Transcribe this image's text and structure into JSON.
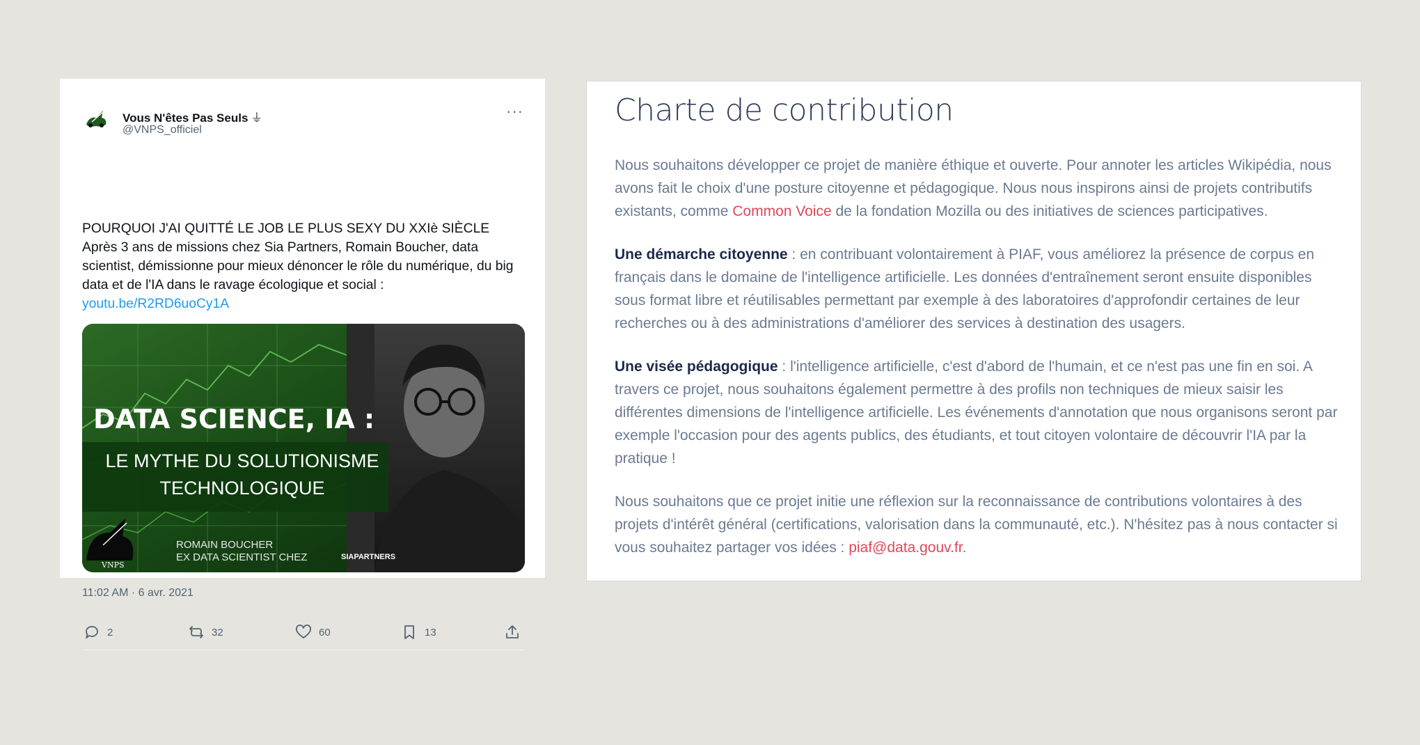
{
  "tweet": {
    "display_name": "Vous N'êtes Pas Seuls",
    "badge_glyph": "⏚",
    "handle": "@VNPS_officiel",
    "more_label": "···",
    "text_line1": "POURQUOI J'AI QUITTÉ LE JOB LE PLUS SEXY DU XXIè SIÈCLE",
    "text_body": "Après 3 ans de missions chez Sia Partners, Romain Boucher, data scientist, démissionne pour mieux dénoncer le rôle du numérique, du big data et de l'IA dans le ravage écologique et social :",
    "link": "youtu.be/R2RD6uoCy1A",
    "media": {
      "headline": "DATA SCIENCE, IA :",
      "subtitle_line1": "LE MYTHE DU SOLUTIONISME",
      "subtitle_line2": "TECHNOLOGIQUE",
      "name_line1": "ROMAIN BOUCHER",
      "name_line2": "EX DATA SCIENTIST CHEZ",
      "company_logo": "SIAPARTNERS",
      "watermark": "VNPS"
    },
    "timestamp": "11:02 AM · 6 avr. 2021",
    "actions": {
      "replies": "2",
      "retweets": "32",
      "likes": "60",
      "bookmarks": "13"
    }
  },
  "charte": {
    "title": "Charte de contribution",
    "p1_a": "Nous souhaitons développer ce projet de manière éthique et ouverte. Pour annoter les articles Wikipédia, nous avons fait le choix d'une posture citoyenne et pédagogique. Nous nous inspirons ainsi de projets contributifs existants, comme ",
    "p1_link": "Common Voice",
    "p1_b": " de la fondation Mozilla ou des initiatives de sciences participatives.",
    "p2_bold": "Une démarche citoyenne",
    "p2_text": " : en contribuant volontairement à PIAF, vous améliorez la présence de corpus en français dans le domaine de l'intelligence artificielle. Les données d'entraînement seront ensuite disponibles sous format libre et réutilisables permettant par exemple à des laboratoires d'approfondir certaines de leur recherches ou à des administrations d'améliorer des services à destination des usagers.",
    "p3_bold": "Une visée pédagogique",
    "p3_text": " : l'intelligence artificielle, c'est d'abord de l'humain, et ce n'est pas une fin en soi. A travers ce projet, nous souhaitons également permettre à des profils non techniques de mieux saisir les différentes dimensions de l'intelligence artificielle. Les événements d'annotation que nous organisons seront par exemple l'occasion pour des agents publics, des étudiants, et tout citoyen volontaire de découvrir l'IA par la pratique !",
    "p4_a": "Nous souhaitons que ce projet initie une réflexion sur la reconnaissance de contributions volontaires à des projets d'intérêt général (certifications, valorisation dans la communauté, etc.). N'hésitez pas à nous contacter si vous souhaitez partager vos idées : ",
    "p4_link": "piaf@data.gouv.fr",
    "p4_b": "."
  },
  "colors": {
    "background": "#e5e4df",
    "tweet_link": "#1d9bf0",
    "charte_link": "#e0475a",
    "charte_title": "#2e3d57",
    "charte_text": "#6b7a90",
    "charte_bold": "#1b2a4a"
  }
}
